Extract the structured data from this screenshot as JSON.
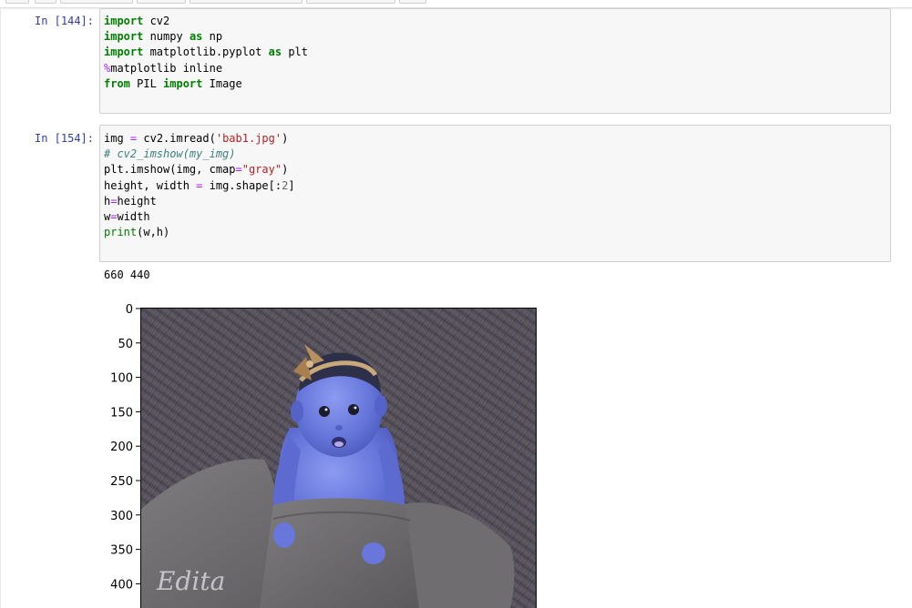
{
  "cells": [
    {
      "prompt": "In [144]:",
      "lines": [
        [
          {
            "t": "kw",
            "v": "import"
          },
          {
            "t": "p",
            "v": " cv2"
          }
        ],
        [
          {
            "t": "kw",
            "v": "import"
          },
          {
            "t": "p",
            "v": " numpy "
          },
          {
            "t": "kw",
            "v": "as"
          },
          {
            "t": "p",
            "v": " np"
          }
        ],
        [
          {
            "t": "kw",
            "v": "import"
          },
          {
            "t": "p",
            "v": " matplotlib.pyplot "
          },
          {
            "t": "kw",
            "v": "as"
          },
          {
            "t": "p",
            "v": " plt"
          }
        ],
        [
          {
            "t": "mg",
            "v": "%"
          },
          {
            "t": "p",
            "v": "matplotlib inline"
          }
        ],
        [
          {
            "t": "kw",
            "v": "from"
          },
          {
            "t": "p",
            "v": " PIL "
          },
          {
            "t": "kw",
            "v": "import"
          },
          {
            "t": "p",
            "v": " Image"
          }
        ]
      ]
    },
    {
      "prompt": "In [154]:",
      "lines": [
        [
          {
            "t": "p",
            "v": "img "
          },
          {
            "t": "op",
            "v": "="
          },
          {
            "t": "p",
            "v": " cv2.imread("
          },
          {
            "t": "str",
            "v": "'bab1.jpg'"
          },
          {
            "t": "p",
            "v": ")"
          }
        ],
        [
          {
            "t": "cm",
            "v": "# cv2_imshow(my_img)"
          }
        ],
        [
          {
            "t": "p",
            "v": "plt.imshow(img, cmap"
          },
          {
            "t": "op",
            "v": "="
          },
          {
            "t": "str",
            "v": "\"gray\""
          },
          {
            "t": "p",
            "v": ")"
          }
        ],
        [
          {
            "t": "p",
            "v": "height, width "
          },
          {
            "t": "op",
            "v": "="
          },
          {
            "t": "p",
            "v": " img.shape[:"
          },
          {
            "t": "num",
            "v": "2"
          },
          {
            "t": "p",
            "v": "]"
          }
        ],
        [
          {
            "t": "p",
            "v": "h"
          },
          {
            "t": "op",
            "v": "="
          },
          {
            "t": "p",
            "v": "height"
          }
        ],
        [
          {
            "t": "p",
            "v": "w"
          },
          {
            "t": "op",
            "v": "="
          },
          {
            "t": "p",
            "v": "width"
          }
        ],
        [
          {
            "t": "bi",
            "v": "print"
          },
          {
            "t": "p",
            "v": "(w,h)"
          }
        ]
      ]
    }
  ],
  "output": {
    "text": "660 440",
    "plot": {
      "y_ticks": [
        "0",
        "50",
        "100",
        "150",
        "200",
        "250",
        "300",
        "350",
        "400"
      ],
      "image_watermark": "Edita"
    }
  },
  "colors": {
    "prompt": "#303f9f",
    "keyword": "#008000",
    "operator": "#aa22ff",
    "string": "#ba2121",
    "comment": "#408080",
    "cell_bg": "#f7f7f7"
  }
}
